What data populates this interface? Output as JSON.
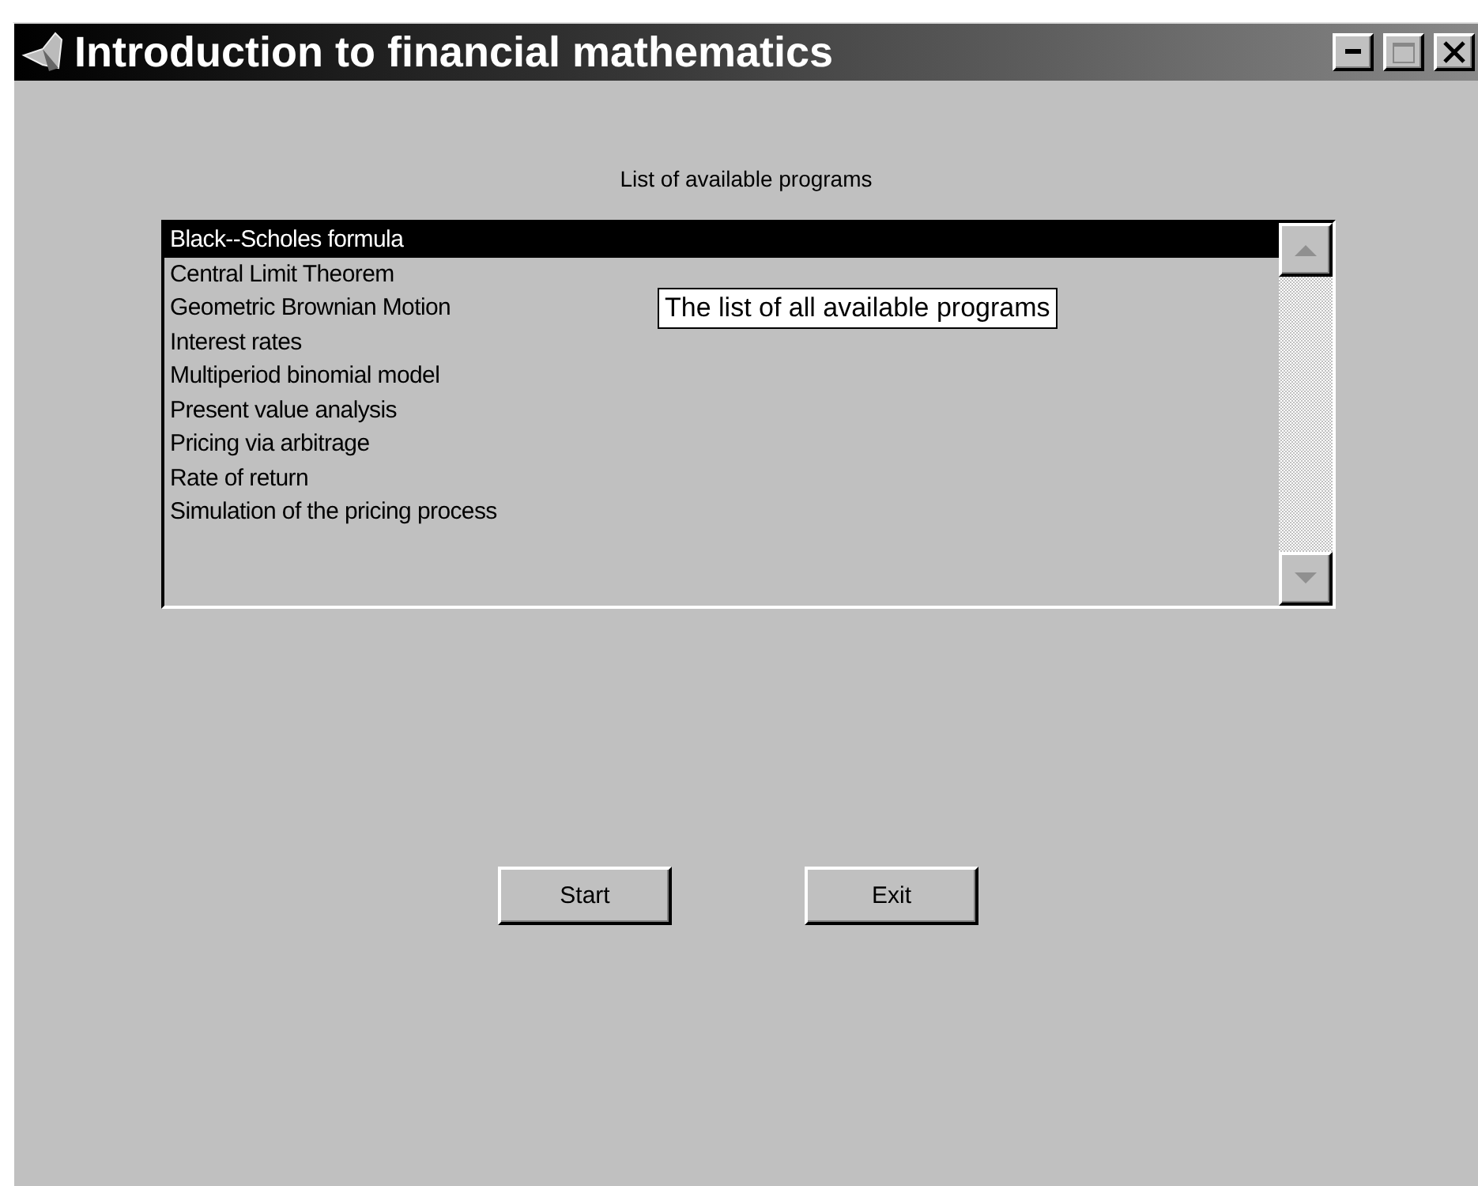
{
  "window": {
    "title": "Introduction to financial mathematics"
  },
  "list_label": "List of available programs",
  "programs": [
    {
      "label": "Black--Scholes formula",
      "selected": true
    },
    {
      "label": "Central Limit Theorem",
      "selected": false
    },
    {
      "label": "Geometric Brownian Motion",
      "selected": false
    },
    {
      "label": "Interest rates",
      "selected": false
    },
    {
      "label": "Multiperiod binomial model",
      "selected": false
    },
    {
      "label": "Present value analysis",
      "selected": false
    },
    {
      "label": "Pricing via arbitrage",
      "selected": false
    },
    {
      "label": "Rate of return",
      "selected": false
    },
    {
      "label": "Simulation of the pricing process",
      "selected": false
    }
  ],
  "tooltip": "The list of all available programs",
  "buttons": [
    "Start",
    "Exit"
  ]
}
